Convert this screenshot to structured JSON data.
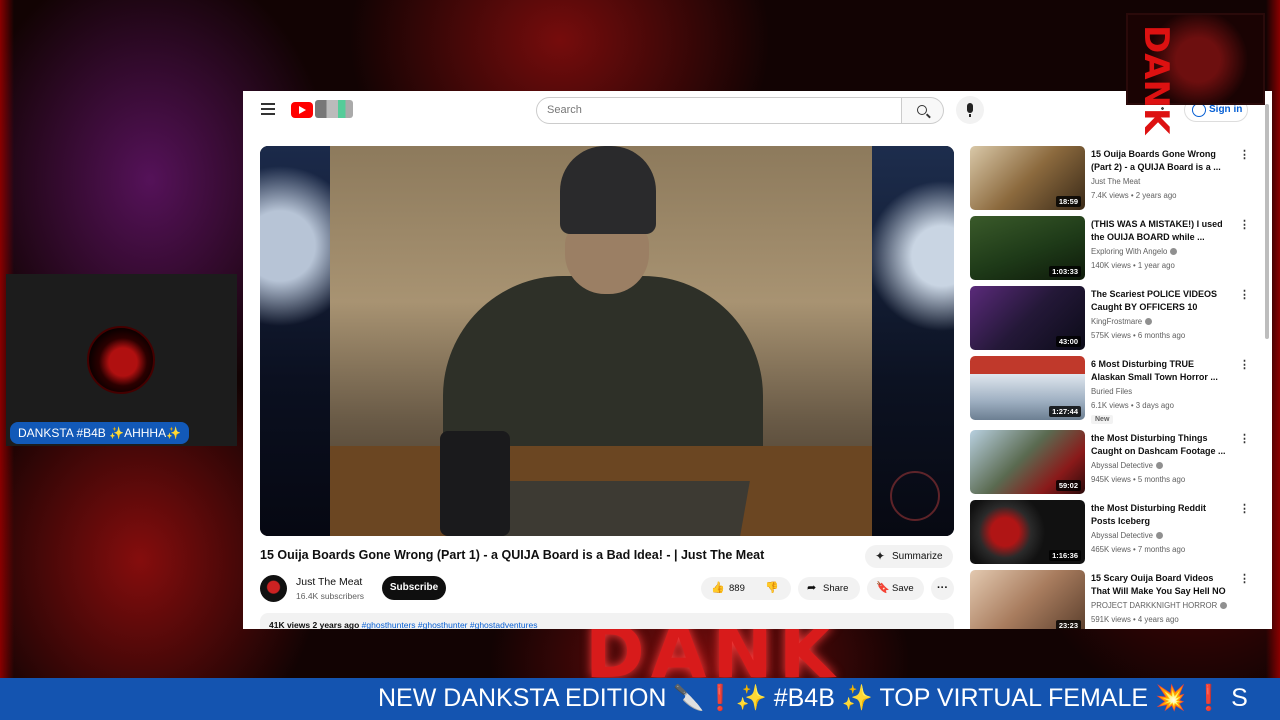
{
  "youtube": {
    "search_placeholder": "Search",
    "sign_in": "Sign in",
    "video": {
      "title": "15 Ouija Boards Gone Wrong (Part 1) - a QUIJA Board is a Bad Idea! - | Just The Meat",
      "summarize_label": "Summarize",
      "channel": "Just The Meat",
      "subscribers": "16.4K subscribers",
      "subscribe_label": "Subscribe",
      "likes": "889",
      "share_label": "Share",
      "save_label": "Save",
      "views": "41K views",
      "age": "2 years ago",
      "tags": "#ghosthunters #ghosthunter #ghostadventures"
    },
    "recommendations": [
      {
        "title": "15 Ouija Boards Gone Wrong (Part 2) - a QUIJA Board is a ...",
        "channel": "Just The Meat",
        "verified": false,
        "meta": "7.4K views • 2 years ago",
        "duration": "18:59",
        "badge": ""
      },
      {
        "title": "(THIS WAS A MISTAKE!) I used the OUIJA BOARD while ...",
        "channel": "Exploring With Angelo",
        "verified": true,
        "meta": "140K views • 1 year ago",
        "duration": "1:03:33",
        "badge": ""
      },
      {
        "title": "The Scariest POLICE VIDEOS Caught BY OFFICERS 10",
        "channel": "KingFrostmare",
        "verified": true,
        "meta": "575K views • 6 months ago",
        "duration": "43:00",
        "badge": ""
      },
      {
        "title": "6 Most Disturbing TRUE Alaskan Small Town Horror ...",
        "channel": "Buried Files",
        "verified": false,
        "meta": "6.1K views • 3 days ago",
        "duration": "1:27:44",
        "badge": "New"
      },
      {
        "title": "the Most Disturbing Things Caught on Dashcam Footage ...",
        "channel": "Abyssal Detective",
        "verified": true,
        "meta": "945K views • 5 months ago",
        "duration": "59:02",
        "badge": ""
      },
      {
        "title": "the Most Disturbing Reddit Posts Iceberg",
        "channel": "Abyssal Detective",
        "verified": true,
        "meta": "465K views • 7 months ago",
        "duration": "1:16:36",
        "badge": ""
      },
      {
        "title": "15 Scary Ouija Board Videos That Will Make You Say Hell NO",
        "channel": "PROJECT DARKKNIGHT HORROR",
        "verified": true,
        "meta": "591K views • 4 years ago",
        "duration": "23:23",
        "badge": ""
      }
    ]
  },
  "stream": {
    "webcam_label": "DANKSTA #B4B ✨AHHHA✨",
    "ticker": "NEW DANKSTA EDITION 🔪❗✨ #B4B ✨ TOP VIRTUAL FEMALE 💥 ❗ S",
    "bottom_brand": "DANK",
    "corner_logo_text": "DANK"
  },
  "colors": {
    "ticker_bg": "#1454b0",
    "accent_red": "#d81b1b",
    "yt_red": "#ff0000",
    "link_blue": "#065fd4"
  }
}
